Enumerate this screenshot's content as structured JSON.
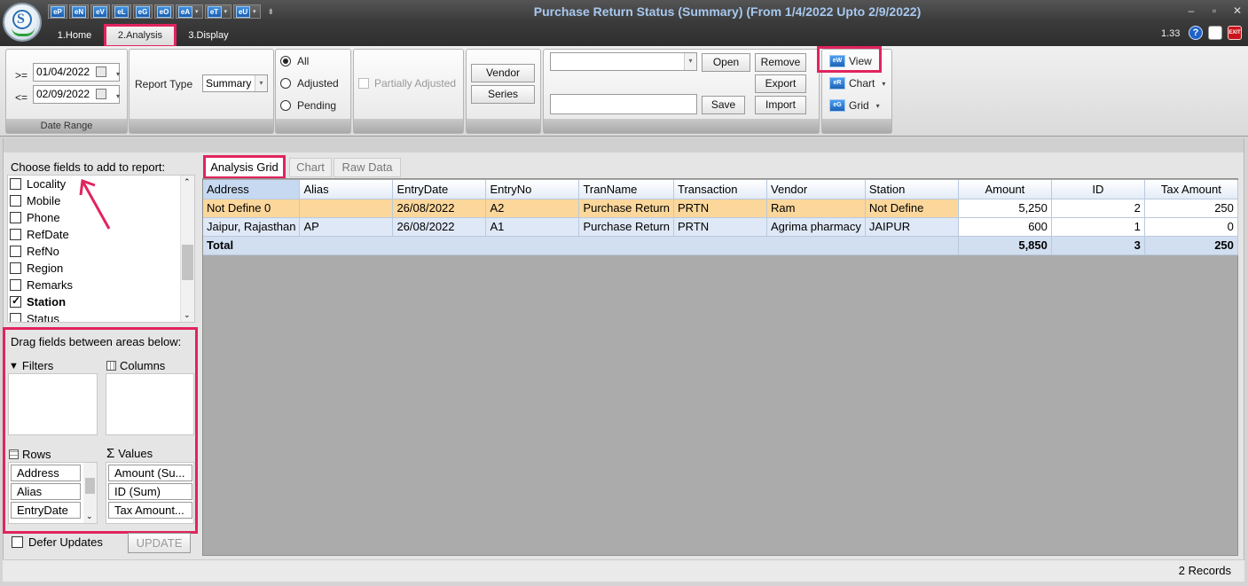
{
  "window": {
    "title": "Purchase Return Status (Summary)  (From 1/4/2022 Upto 2/9/2022)",
    "version": "1.33",
    "controls": {
      "minimize": "–",
      "restore": "▫",
      "close": "✕"
    }
  },
  "quick_access": [
    "eP",
    "eN",
    "eV",
    "eL",
    "eG",
    "eO",
    "eA",
    "eT",
    "eU"
  ],
  "ribbon_tabs": [
    {
      "label": "1.Home"
    },
    {
      "label": "2.Analysis"
    },
    {
      "label": "3.Display"
    }
  ],
  "date_range": {
    "group_label": "Date Range",
    "from_op": ">=",
    "from_value": "01/04/2022",
    "to_op": "<=",
    "to_value": "02/09/2022"
  },
  "report_type": {
    "label": "Report Type",
    "value": "Summary"
  },
  "status_filter": {
    "options": [
      "All",
      "Adjusted",
      "Pending"
    ],
    "selected": "All",
    "partially_adjusted": "Partially Adjusted"
  },
  "selection": {
    "vendor": "Vendor",
    "series": "Series"
  },
  "layout_buttons": {
    "open": "Open",
    "remove": "Remove",
    "export": "Export",
    "save": "Save",
    "import": "Import"
  },
  "view_buttons": {
    "view": "View",
    "chart": "Chart",
    "grid": "Grid",
    "view_icon": "eW",
    "chart_icon": "eR",
    "grid_icon": "eG"
  },
  "field_chooser": {
    "title": "Choose fields to add to report:",
    "fields": [
      {
        "label": "Locality",
        "checked": false
      },
      {
        "label": "Mobile",
        "checked": false
      },
      {
        "label": "Phone",
        "checked": false
      },
      {
        "label": "RefDate",
        "checked": false
      },
      {
        "label": "RefNo",
        "checked": false
      },
      {
        "label": "Region",
        "checked": false
      },
      {
        "label": "Remarks",
        "checked": false
      },
      {
        "label": "Station",
        "checked": true
      },
      {
        "label": "Status",
        "checked": false
      }
    ],
    "drag_title": "Drag fields between areas below:",
    "filters_label": "Filters",
    "columns_label": "Columns",
    "rows_label": "Rows",
    "values_label": "Values",
    "rows": [
      "Address",
      "Alias",
      "EntryDate"
    ],
    "values": [
      "Amount (Su...",
      "ID (Sum)",
      "Tax Amount..."
    ],
    "defer_label": "Defer Updates",
    "update_label": "UPDATE"
  },
  "view_tabs": [
    "Analysis Grid",
    "Chart",
    "Raw Data"
  ],
  "grid": {
    "columns": [
      "Address",
      "Alias",
      "EntryDate",
      "EntryNo",
      "TranName",
      "Transaction",
      "Vendor",
      "Station",
      "Amount",
      "ID",
      "Tax Amount"
    ],
    "rows": [
      [
        "Not Define 0",
        "",
        "26/08/2022",
        "A2",
        "Purchase Return",
        "PRTN",
        "Ram",
        "Not Define",
        "5,250",
        "2",
        "250"
      ],
      [
        "Jaipur, Rajasthan",
        "AP",
        "26/08/2022",
        "A1",
        "Purchase Return",
        "PRTN",
        "Agrima pharmacy",
        "JAIPUR",
        "600",
        "1",
        "0"
      ]
    ],
    "total": [
      "Total",
      "5,850",
      "3",
      "250"
    ]
  },
  "status": {
    "records": "2 Records"
  }
}
